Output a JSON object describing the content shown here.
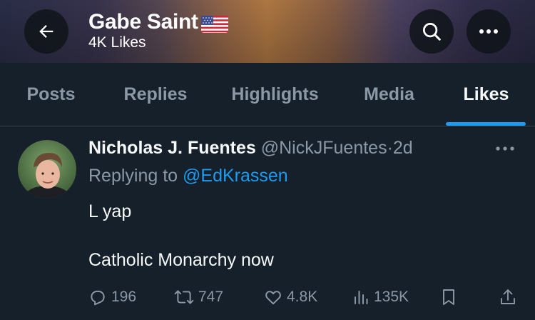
{
  "header": {
    "name": "Gabe Saint",
    "flag_emoji": "🇺🇸",
    "subtitle": "4K Likes"
  },
  "tabs": [
    {
      "label": "Posts"
    },
    {
      "label": "Replies"
    },
    {
      "label": "Highlights"
    },
    {
      "label": "Media"
    },
    {
      "label": "Likes"
    }
  ],
  "active_tab": "Likes",
  "tweet": {
    "author_name": "Nicholas J. Fuentes",
    "handle": "@NickJFuentes",
    "separator": "·",
    "time": "2d",
    "replying_prefix": "Replying to",
    "replying_to": "@EdKrassen",
    "line1": "L yap",
    "line2": "Catholic Monarchy now",
    "replies": "196",
    "reposts": "747",
    "likes": "4.8K",
    "views": "135K"
  },
  "colors": {
    "background": "#15202b",
    "accent": "#1d9bf0",
    "muted": "#8b98a5",
    "text": "#f7f9f9"
  },
  "icons": [
    "back-arrow-icon",
    "search-icon",
    "more-horizontal-icon",
    "reply-icon",
    "repost-icon",
    "like-icon",
    "views-icon",
    "bookmark-icon",
    "share-icon"
  ]
}
